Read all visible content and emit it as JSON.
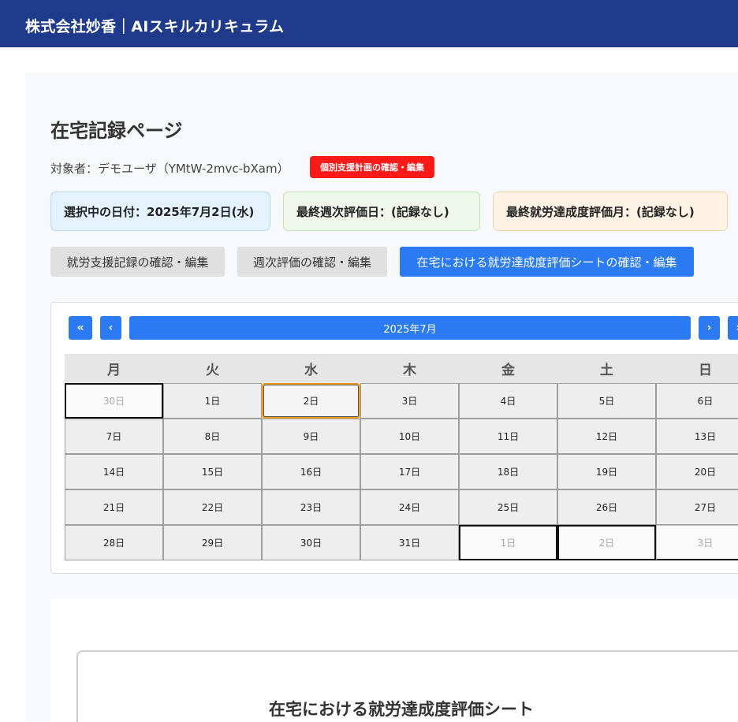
{
  "header": {
    "brand": "株式会社妙香｜AIスキルカリキュラム"
  },
  "page": {
    "title": "在宅記録ページ",
    "subject": "対象者：デモユーザ（YMtW-2mvc-bXam）",
    "support_plan_button": "個別支援計画の確認・編集",
    "info": {
      "selected_date": "選択中の日付：2025年7月2日(水)",
      "last_weekly": "最終週次評価日：(記録なし)",
      "last_monthly": "最終就労達成度評価月：(記録なし)"
    },
    "nav": {
      "work_support": "就労支援記録の確認・編集",
      "weekly_eval": "週次評価の確認・編集",
      "achievement_sheet": "在宅における就労達成度評価シートの確認・編集"
    },
    "colors": {
      "header_bg": "#1f3a8a",
      "primary": "#2b7bf5",
      "danger": "#ff1a1a",
      "selected_border": "#f0a020"
    }
  },
  "calendar": {
    "prev_year": "«",
    "prev_month": "‹",
    "month_label": "2025年7月",
    "next_month": "›",
    "next_year": "»",
    "weekdays": [
      "月",
      "火",
      "水",
      "木",
      "金",
      "土",
      "日"
    ],
    "selected_day": "2日",
    "weeks": [
      [
        "30日",
        "1日",
        "2日",
        "3日",
        "4日",
        "5日",
        "6日"
      ],
      [
        "7日",
        "8日",
        "9日",
        "10日",
        "11日",
        "12日",
        "13日"
      ],
      [
        "14日",
        "15日",
        "16日",
        "17日",
        "18日",
        "19日",
        "20日"
      ],
      [
        "21日",
        "22日",
        "23日",
        "24日",
        "25日",
        "26日",
        "27日"
      ],
      [
        "28日",
        "29日",
        "30日",
        "31日",
        "1日",
        "2日",
        "3日"
      ]
    ]
  },
  "sheet": {
    "title": "在宅における就労達成度評価シート"
  }
}
